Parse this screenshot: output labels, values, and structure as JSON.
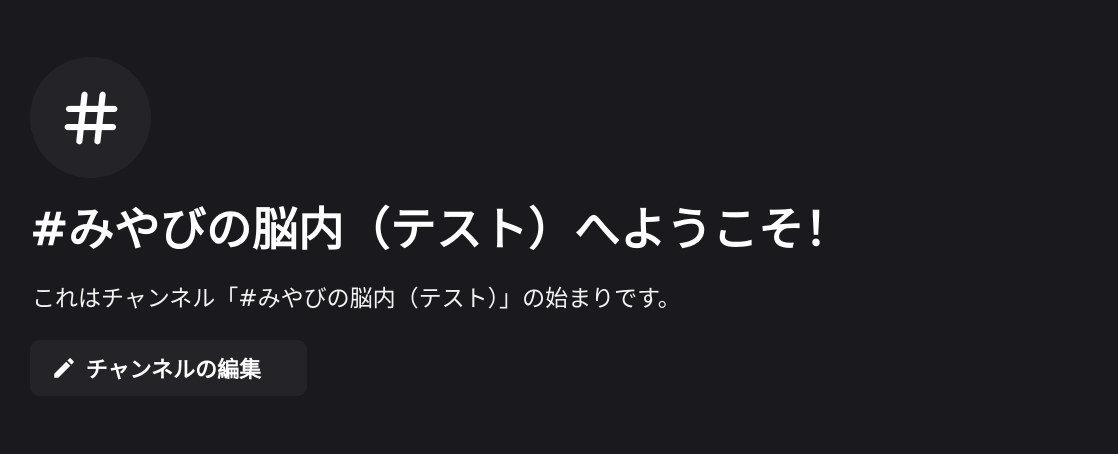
{
  "channel_welcome": {
    "icon": "hash-icon",
    "title": "#みやびの脳内（テスト）へようこそ！",
    "subtitle": "これはチャンネル「#みやびの脳内（テスト）」の始まりです。",
    "edit_button": {
      "icon": "pencil-icon",
      "label": "チャンネルの編集"
    }
  },
  "colors": {
    "background": "#1a1a1e",
    "icon_circle": "#242428",
    "button_bg": "#242428",
    "text": "#ffffff"
  }
}
